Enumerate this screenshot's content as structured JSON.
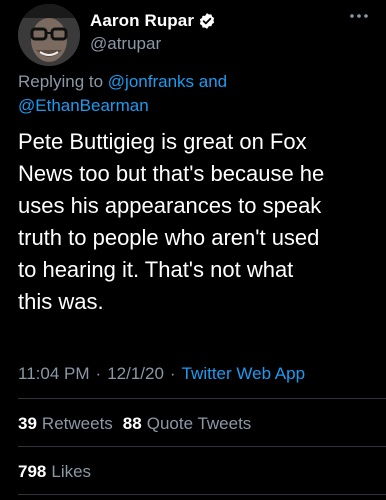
{
  "author": {
    "display_name": "Aaron Rupar",
    "handle": "@atrupar",
    "verified_icon": "verified-badge-icon",
    "avatar_icon": "avatar-icon"
  },
  "reply": {
    "prefix": "Replying to",
    "mentions_line1": "@jonfranks and",
    "mentions_line2": "@EthanBearman"
  },
  "tweet": {
    "text": "Pete Buttigieg is great on Fox\nNews too but that's because he\nuses his appearances to speak\ntruth to people who aren't used\nto hearing it. That's not what\nthis was."
  },
  "meta": {
    "time": "11:04 PM",
    "date": "12/1/20",
    "source": "Twitter Web App",
    "sep1": "·",
    "sep2": "·"
  },
  "stats": {
    "retweets_count": "39",
    "retweets_label": "Retweets",
    "quote_count": "88",
    "quote_label": "Quote Tweets",
    "likes_count": "798",
    "likes_label": "Likes"
  },
  "icons": {
    "more": "more-options-icon"
  },
  "colors": {
    "background": "#000000",
    "text": "#ffffff",
    "secondary": "#8b98a5",
    "accent": "#1d9bf0",
    "divider": "#2f3336"
  }
}
